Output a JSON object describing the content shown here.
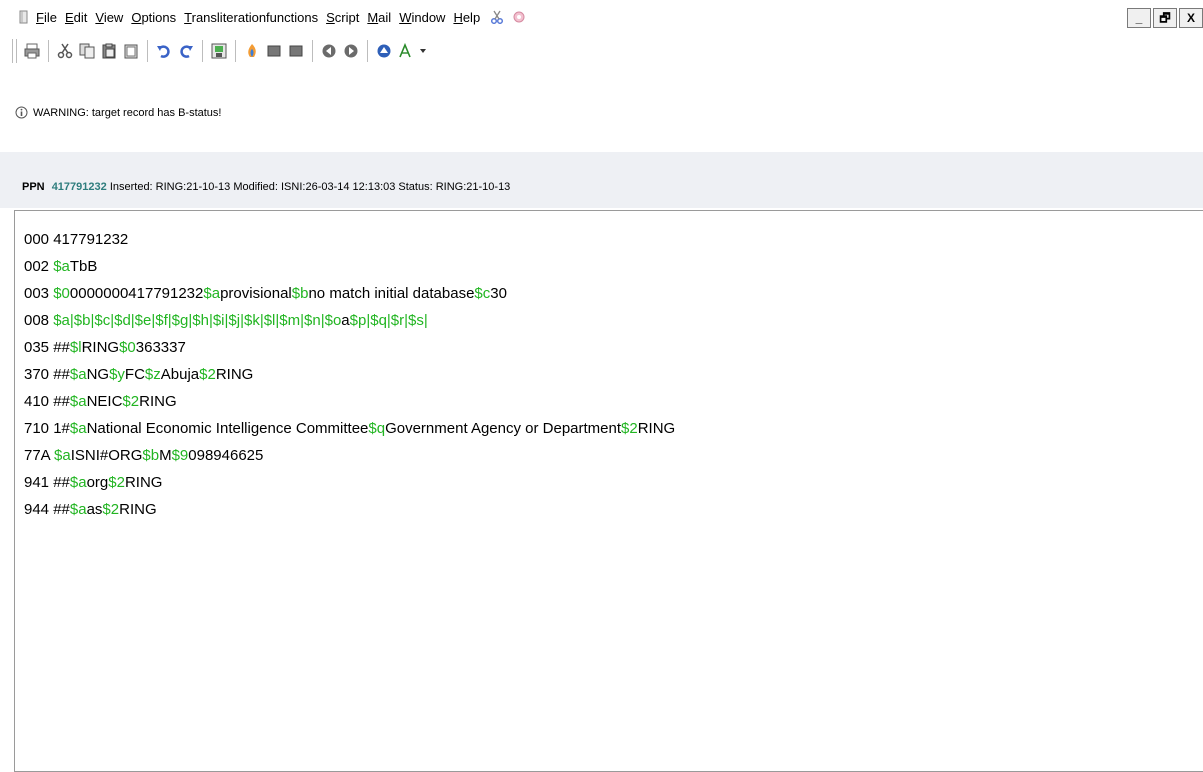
{
  "menu": {
    "items": [
      "File",
      "Edit",
      "View",
      "Options",
      "Transliterationfunctions",
      "Script",
      "Mail",
      "Window",
      "Help"
    ]
  },
  "window_controls": {
    "minimize": "_",
    "restore": "🗗",
    "close": "X"
  },
  "toolbar": {
    "buttons": [
      "print",
      "cut",
      "copy",
      "paste",
      "clipboard",
      "undo",
      "redo",
      "save",
      "fire",
      "gray-box-1",
      "gray-box-2",
      "back",
      "forward",
      "up",
      "font"
    ]
  },
  "message": {
    "text": "WARNING: target record has B-status!"
  },
  "record_header": {
    "ppn_label": "PPN",
    "ppn_value": "417791232",
    "details": "Inserted: RING:21-10-13 Modified: ISNI:26-03-14 12:13:03 Status: RING:21-10-13"
  },
  "record_lines": [
    [
      {
        "t": "000 417791232",
        "c": "k"
      }
    ],
    [
      {
        "t": "002 ",
        "c": "k"
      },
      {
        "t": "$a",
        "c": "s"
      },
      {
        "t": "TbB",
        "c": "k"
      }
    ],
    [
      {
        "t": "003 ",
        "c": "k"
      },
      {
        "t": "$0",
        "c": "s"
      },
      {
        "t": "0000000417791232",
        "c": "k"
      },
      {
        "t": "$a",
        "c": "s"
      },
      {
        "t": "provisional",
        "c": "k"
      },
      {
        "t": "$b",
        "c": "s"
      },
      {
        "t": "no match initial database",
        "c": "k"
      },
      {
        "t": "$c",
        "c": "s"
      },
      {
        "t": "30",
        "c": "k"
      }
    ],
    [
      {
        "t": "008 ",
        "c": "k"
      },
      {
        "t": "$a|$b|$c|$d|$e|$f|$g|$h|$i|$j|$k|$l|$m|$n|$o",
        "c": "s"
      },
      {
        "t": "a",
        "c": "k"
      },
      {
        "t": "$p|$q|$r|$s|",
        "c": "s"
      }
    ],
    [
      {
        "t": "035 ##",
        "c": "k"
      },
      {
        "t": "$l",
        "c": "s"
      },
      {
        "t": "RING",
        "c": "k"
      },
      {
        "t": "$0",
        "c": "s"
      },
      {
        "t": "363337",
        "c": "k"
      }
    ],
    [
      {
        "t": "370 ##",
        "c": "k"
      },
      {
        "t": "$a",
        "c": "s"
      },
      {
        "t": "NG",
        "c": "k"
      },
      {
        "t": "$y",
        "c": "s"
      },
      {
        "t": "FC",
        "c": "k"
      },
      {
        "t": "$z",
        "c": "s"
      },
      {
        "t": "Abuja",
        "c": "k"
      },
      {
        "t": "$2",
        "c": "s"
      },
      {
        "t": "RING",
        "c": "k"
      }
    ],
    [
      {
        "t": "410 ##",
        "c": "k"
      },
      {
        "t": "$a",
        "c": "s"
      },
      {
        "t": "NEIC",
        "c": "k"
      },
      {
        "t": "$2",
        "c": "s"
      },
      {
        "t": "RING",
        "c": "k"
      }
    ],
    [
      {
        "t": "710 1#",
        "c": "k"
      },
      {
        "t": "$a",
        "c": "s"
      },
      {
        "t": "National Economic Intelligence Committee",
        "c": "k"
      },
      {
        "t": "$q",
        "c": "s"
      },
      {
        "t": "Government Agency or Department",
        "c": "k"
      },
      {
        "t": "$2",
        "c": "s"
      },
      {
        "t": "RING",
        "c": "k"
      }
    ],
    [
      {
        "t": "77A ",
        "c": "k"
      },
      {
        "t": "$a",
        "c": "s"
      },
      {
        "t": "ISNI#ORG",
        "c": "k"
      },
      {
        "t": "$b",
        "c": "s"
      },
      {
        "t": "M",
        "c": "k"
      },
      {
        "t": "$9",
        "c": "s"
      },
      {
        "t": "098946625",
        "c": "k"
      }
    ],
    [
      {
        "t": "941 ##",
        "c": "k"
      },
      {
        "t": "$a",
        "c": "s"
      },
      {
        "t": "org",
        "c": "k"
      },
      {
        "t": "$2",
        "c": "s"
      },
      {
        "t": "RING",
        "c": "k"
      }
    ],
    [
      {
        "t": "944 ##",
        "c": "k"
      },
      {
        "t": "$a",
        "c": "s"
      },
      {
        "t": "as",
        "c": "k"
      },
      {
        "t": "$2",
        "c": "s"
      },
      {
        "t": "RING",
        "c": "k"
      }
    ]
  ],
  "colors": {
    "subfield": "#22b522",
    "ppn": "#2e7d7d"
  }
}
